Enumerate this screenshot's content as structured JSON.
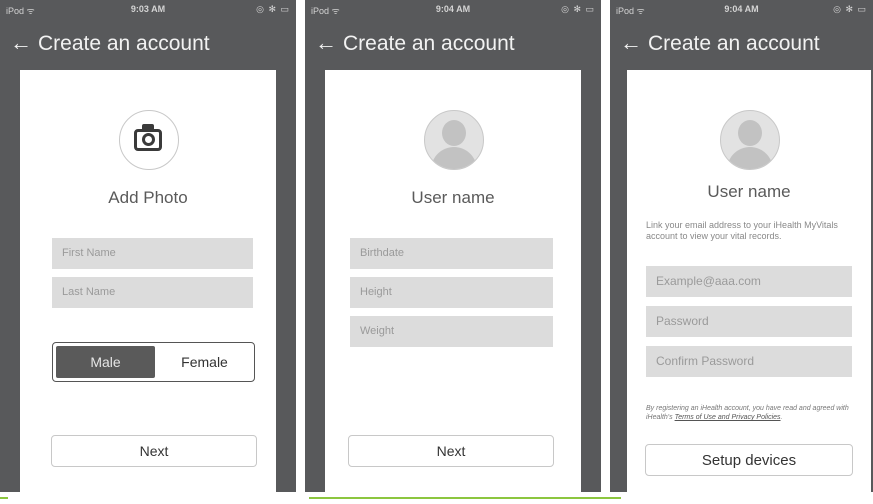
{
  "screens": [
    {
      "status": {
        "carrier": "iPod ᯤ",
        "time": "9:03 AM",
        "icons": "◎ ✻ ▭"
      },
      "nav": {
        "back_icon": "arrow-left-icon",
        "title": "Create an account"
      },
      "photo": {
        "icon": "camera-icon",
        "label": "Add Photo"
      },
      "fields": [
        {
          "placeholder": "First Name"
        },
        {
          "placeholder": "Last Name"
        }
      ],
      "gender": {
        "options": [
          "Male",
          "Female"
        ],
        "selected": "Male"
      },
      "button_label": "Next"
    },
    {
      "status": {
        "carrier": "iPod ᯤ",
        "time": "9:04 AM",
        "icons": "◎ ✻ ▭"
      },
      "nav": {
        "back_icon": "arrow-left-icon",
        "title": "Create an account"
      },
      "avatar": {
        "icon": "user-avatar-icon"
      },
      "user_name": "User name",
      "fields": [
        {
          "placeholder": "Birthdate"
        },
        {
          "placeholder": "Height"
        },
        {
          "placeholder": "Weight"
        }
      ],
      "button_label": "Next"
    },
    {
      "status": {
        "carrier": "iPod ᯤ",
        "time": "9:04 AM",
        "icons": "◎ ✻ ▭"
      },
      "nav": {
        "back_icon": "arrow-left-icon",
        "title": "Create an account"
      },
      "avatar": {
        "icon": "user-avatar-icon"
      },
      "user_name": "User name",
      "description": "Link your email address to your iHealth MyVitals account to view your vital records.",
      "fields": [
        {
          "placeholder": "Example@aaa.com"
        },
        {
          "placeholder": "Password"
        },
        {
          "placeholder": "Confirm Password"
        }
      ],
      "legal": {
        "prefix": "By registering an iHealth account, you have read and agreed with iHealth's ",
        "link": "Terms of Use and Privacy Policies",
        "suffix": "."
      },
      "button_label": "Setup devices"
    }
  ],
  "colors": {
    "frame": "#58595b",
    "field": "#dcdcdc",
    "accent_line": "#8cc63f"
  }
}
